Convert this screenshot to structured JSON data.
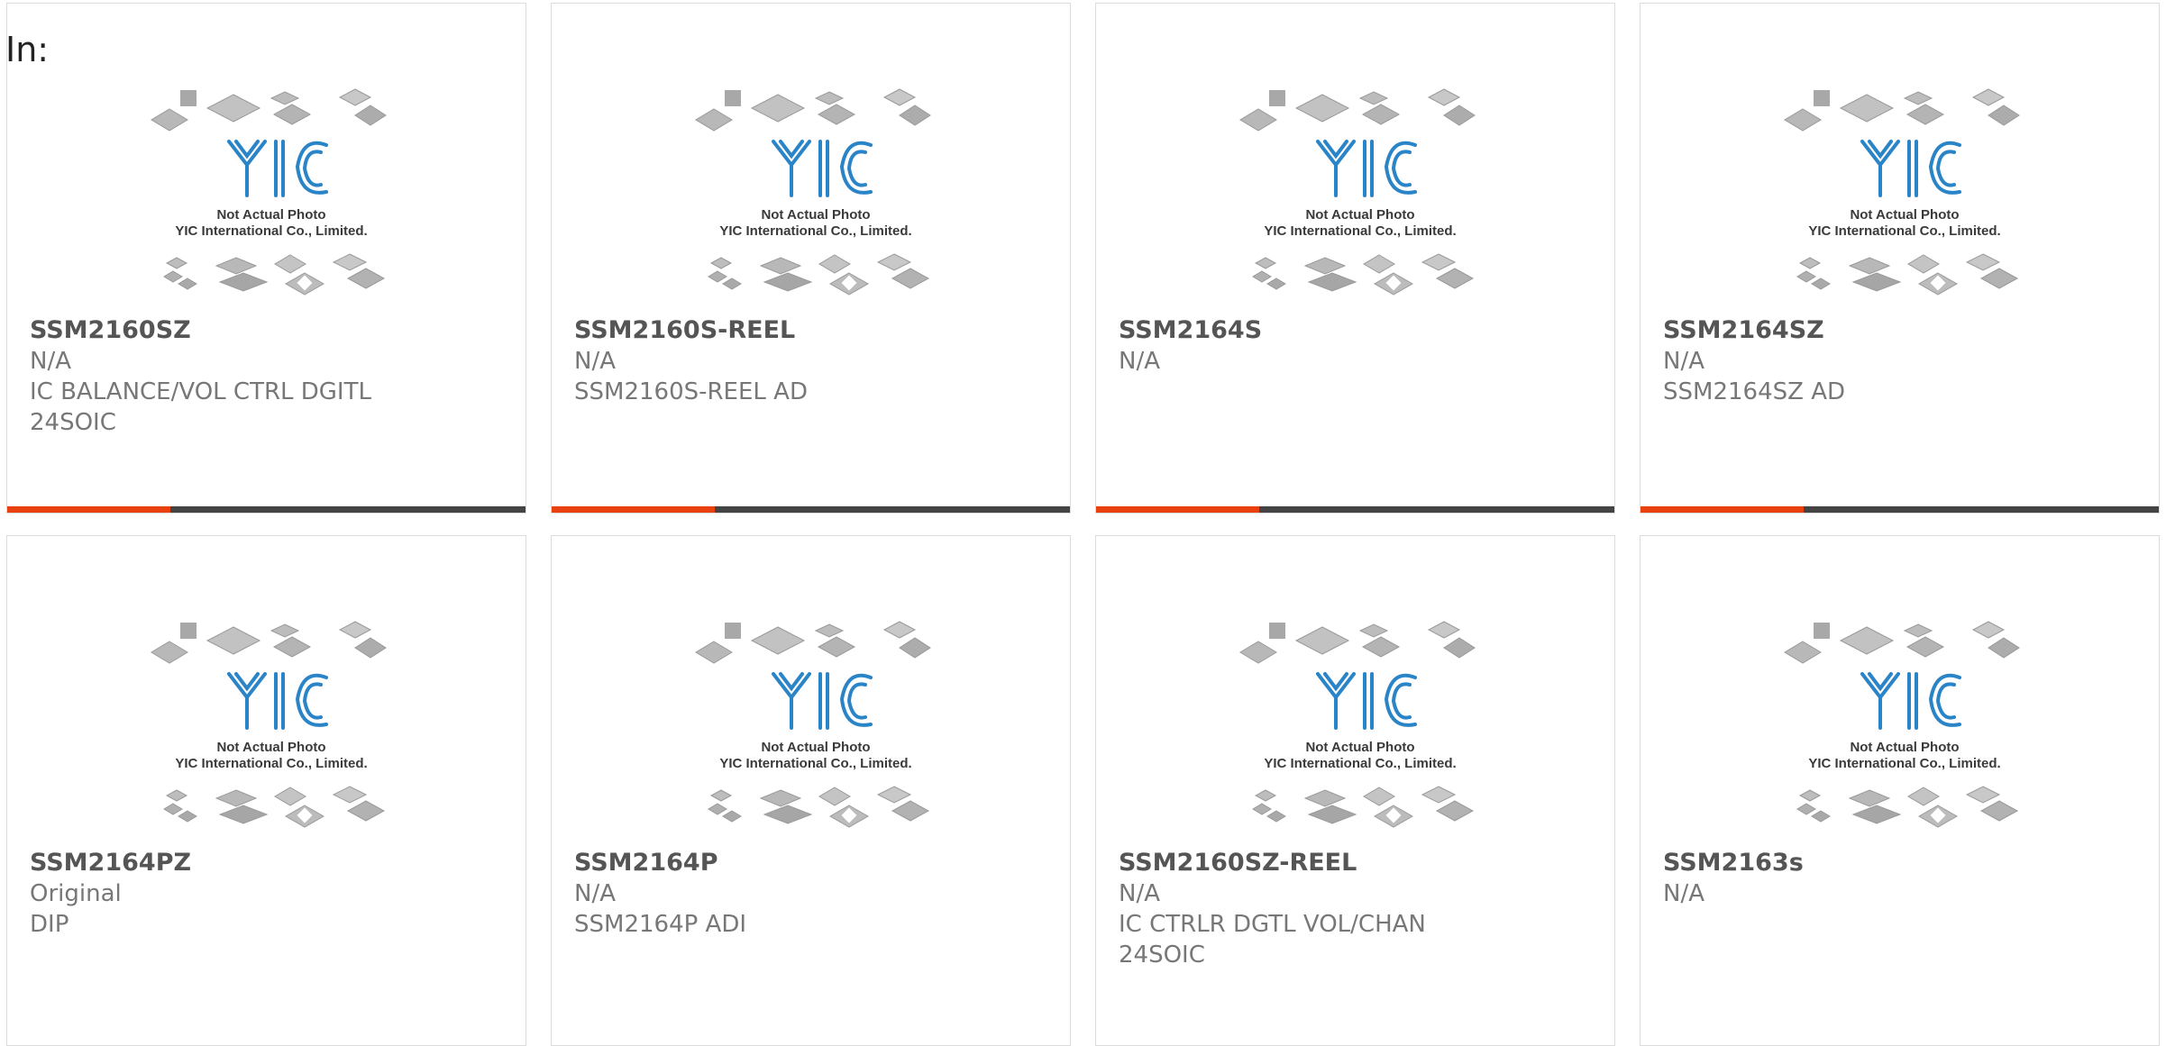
{
  "page": {
    "label": "In:"
  },
  "accent_color": "#e8400f",
  "bar_color": "#444444",
  "thumbnail": {
    "caption_line1": "Not Actual Photo",
    "caption_line2": "YIC International Co., Limited.",
    "logo_text": "YIC"
  },
  "products": [
    {
      "name": "SSM2160SZ",
      "lines": [
        "N/A",
        "IC BALANCE/VOL CTRL DGITL",
        "24SOIC"
      ]
    },
    {
      "name": "SSM2160S-REEL",
      "lines": [
        "N/A",
        "SSM2160S-REEL AD",
        ""
      ]
    },
    {
      "name": "SSM2164S",
      "lines": [
        "N/A",
        "",
        ""
      ]
    },
    {
      "name": "SSM2164SZ",
      "lines": [
        "N/A",
        "SSM2164SZ AD",
        ""
      ]
    },
    {
      "name": "SSM2164PZ",
      "lines": [
        "Original",
        "DIP",
        ""
      ]
    },
    {
      "name": "SSM2164P",
      "lines": [
        "N/A",
        "SSM2164P ADI",
        ""
      ]
    },
    {
      "name": "SSM2160SZ-REEL",
      "lines": [
        "N/A",
        "IC CTRLR DGTL VOL/CHAN",
        "24SOIC"
      ]
    },
    {
      "name": "SSM2163s",
      "lines": [
        "N/A",
        "",
        ""
      ]
    }
  ]
}
